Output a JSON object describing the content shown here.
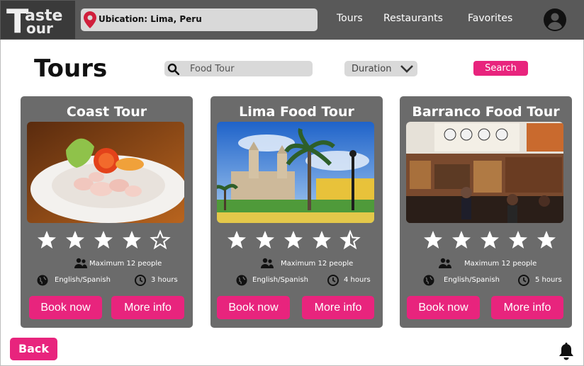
{
  "header": {
    "logo_line1": "aste",
    "logo_line2": "our",
    "logo_big_letter": "T",
    "location_text": "Ubication: Lima, Peru",
    "nav": [
      "Tours",
      "Restaurants",
      "Favorites"
    ]
  },
  "page": {
    "title": "Tours",
    "search_placeholder": "Food Tour",
    "duration_label": "Duration",
    "search_button": "Search",
    "back_button": "Back"
  },
  "cards": [
    {
      "title": "Coast Tour",
      "rating": 4,
      "max_people": "Maximum 12 people",
      "languages": "English/Spanish",
      "duration": "3 hours",
      "book": "Book now",
      "info": "More info"
    },
    {
      "title": "Lima Food Tour",
      "rating": 4.5,
      "max_people": "Maximum 12 people",
      "languages": "English/Spanish",
      "duration": "4 hours",
      "book": "Book now",
      "info": "More info"
    },
    {
      "title": "Barranco Food Tour",
      "rating": 5,
      "max_people": "Maximum 12 people",
      "languages": "English/Spanish",
      "duration": "5 hours",
      "book": "Book now",
      "info": "More info"
    }
  ],
  "colors": {
    "accent": "#e8247d",
    "header_bg": "#595959",
    "card_bg": "#6b6b6b",
    "input_bg": "#d9d9d9"
  },
  "icons": [
    "location-pin-icon",
    "user-avatar-icon",
    "search-icon",
    "chevron-down-icon",
    "group-icon",
    "globe-icon",
    "clock-icon",
    "star-icon",
    "bell-icon"
  ]
}
